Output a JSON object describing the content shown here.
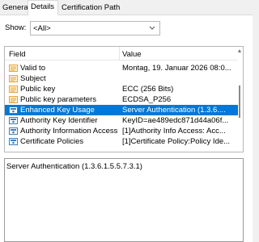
{
  "tabs": [
    "General",
    "Details",
    "Certification Path"
  ],
  "show": {
    "label": "Show:",
    "value": "<All>"
  },
  "columns": {
    "field": "Field",
    "value": "Value"
  },
  "rows": [
    {
      "field": "Valid to",
      "value": "Montag, 19. Januar 2026 08:0...",
      "icon": "cert-field-icon"
    },
    {
      "field": "Subject",
      "value": "",
      "icon": "cert-field-icon"
    },
    {
      "field": "Public key",
      "value": "ECC (256 Bits)",
      "icon": "cert-field-icon"
    },
    {
      "field": "Public key parameters",
      "value": "ECDSA_P256",
      "icon": "cert-field-icon"
    },
    {
      "field": "Enhanced Key Usage",
      "value": "Server Authentication (1.3.6....",
      "icon": "cert-extension-icon"
    },
    {
      "field": "Authority Key Identifier",
      "value": "KeyID=ae489edc871d44a06f...",
      "icon": "cert-extension-icon"
    },
    {
      "field": "Authority Information Access",
      "value": "[1]Authority Info Access: Acc...",
      "icon": "cert-extension-icon"
    },
    {
      "field": "Certificate Policies",
      "value": "[1]Certificate Policy:Policy Ide...",
      "icon": "cert-extension-icon"
    }
  ],
  "selected_index": 4,
  "detail_text": "Server Authentication (1.3.6.1.5.5.7.3.1)",
  "colors": {
    "selection": "#0078d7",
    "field_icon": "#e8a33a",
    "extension_icon": "#3f7fb5"
  }
}
